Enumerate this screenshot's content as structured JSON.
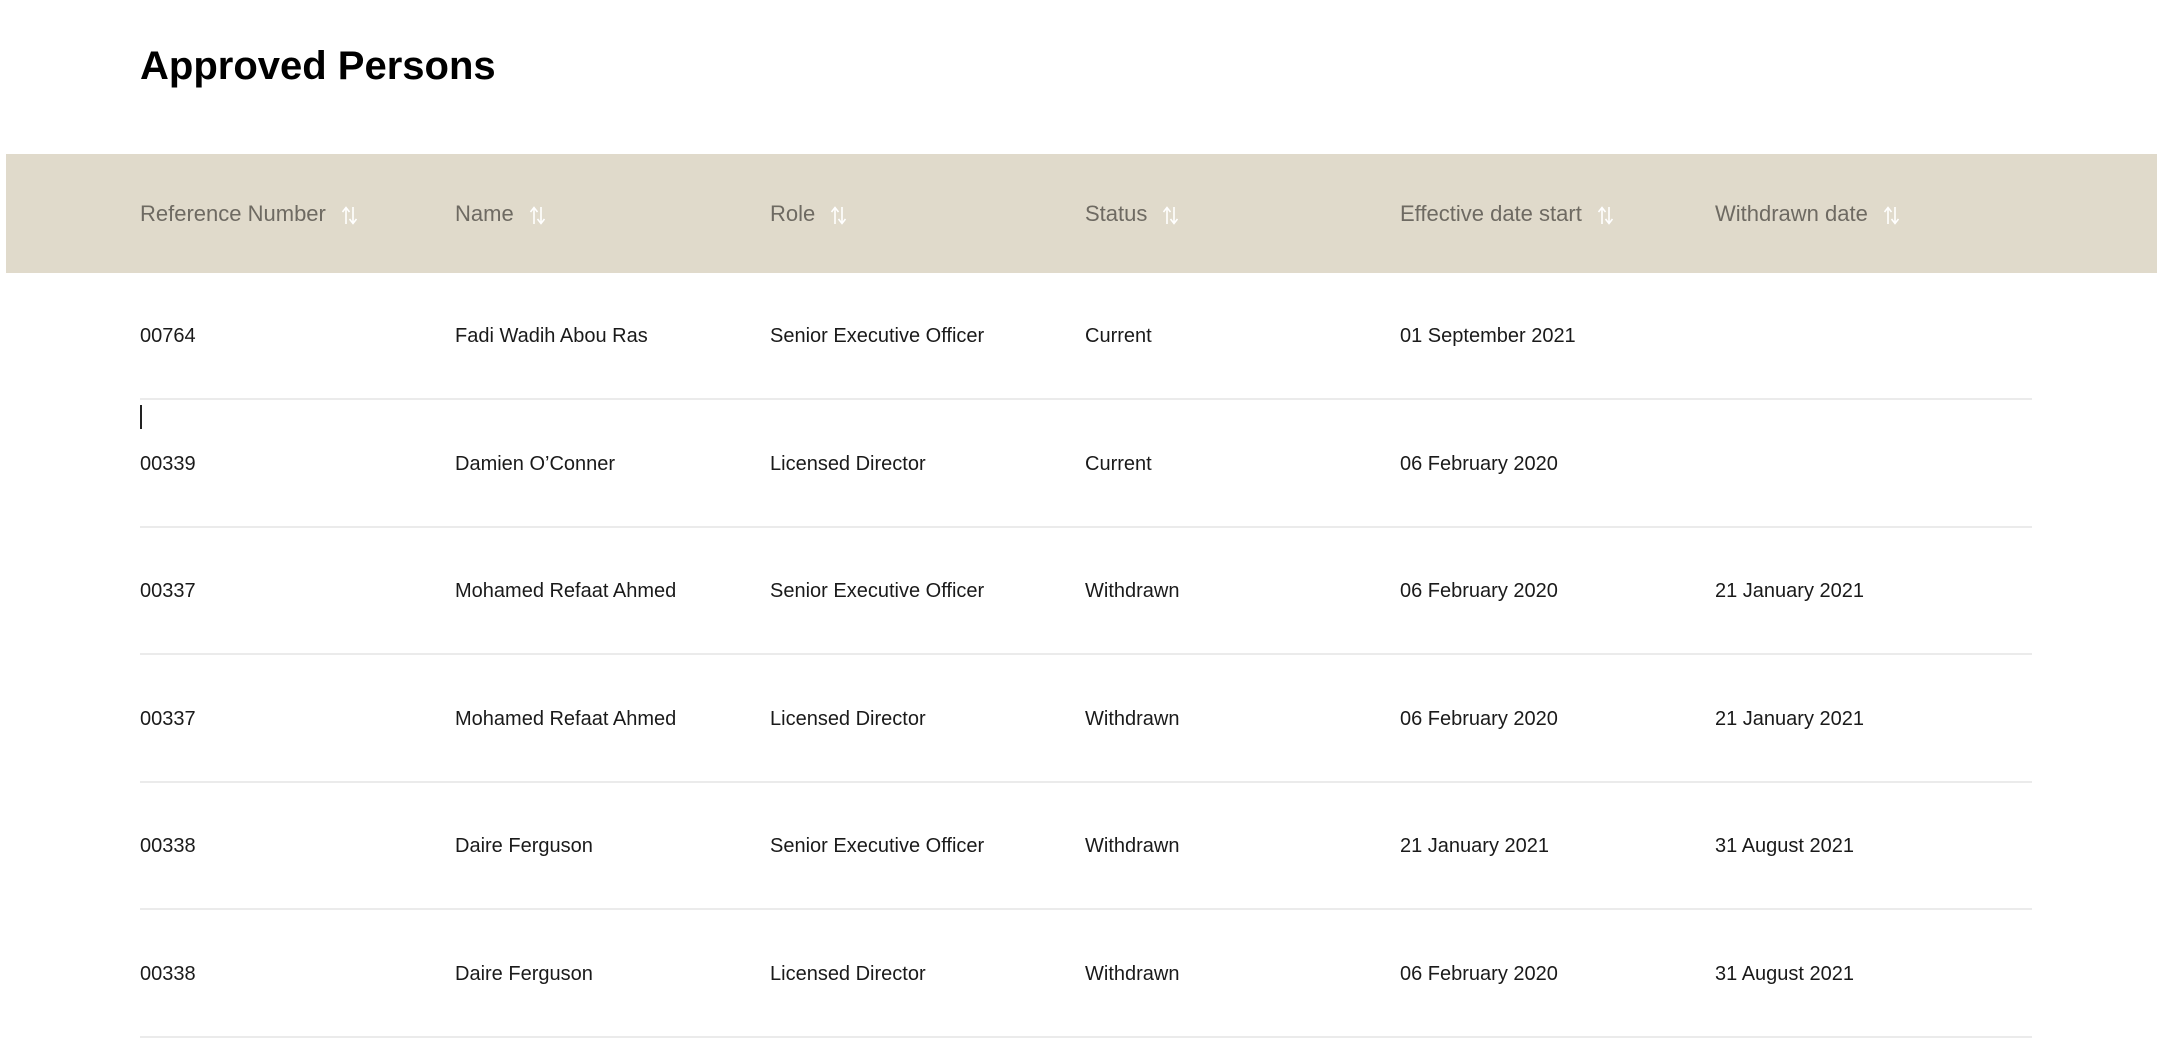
{
  "page": {
    "title": "Approved Persons"
  },
  "table": {
    "columns": [
      {
        "label": "Reference Number",
        "sort_icon": "sort-up-down-icon"
      },
      {
        "label": "Name",
        "sort_icon": "sort-up-down-icon"
      },
      {
        "label": "Role",
        "sort_icon": "sort-up-down-icon"
      },
      {
        "label": "Status",
        "sort_icon": "sort-up-down-icon"
      },
      {
        "label": "Effective date start",
        "sort_icon": "sort-up-down-icon"
      },
      {
        "label": "Withdrawn date",
        "sort_icon": "sort-up-down-icon"
      }
    ],
    "rows": [
      {
        "ref": "00764",
        "name": "Fadi Wadih Abou Ras",
        "role": "Senior Executive Officer",
        "status": "Current",
        "start": "01 September 2021",
        "withdrawn": ""
      },
      {
        "ref": "00339",
        "name": "Damien O’Conner",
        "role": "Licensed Director",
        "status": "Current",
        "start": "06 February 2020",
        "withdrawn": ""
      },
      {
        "ref": "00337",
        "name": "Mohamed Refaat Ahmed",
        "role": "Senior Executive Officer",
        "status": "Withdrawn",
        "start": "06 February 2020",
        "withdrawn": "21 January 2021"
      },
      {
        "ref": "00337",
        "name": "Mohamed Refaat Ahmed",
        "role": "Licensed Director",
        "status": "Withdrawn",
        "start": "06 February 2020",
        "withdrawn": "21 January 2021"
      },
      {
        "ref": "00338",
        "name": "Daire Ferguson",
        "role": "Senior Executive Officer",
        "status": "Withdrawn",
        "start": "21 January 2021",
        "withdrawn": "31 August 2021"
      },
      {
        "ref": "00338",
        "name": "Daire Ferguson",
        "role": "Licensed Director",
        "status": "Withdrawn",
        "start": "06 February 2020",
        "withdrawn": "31 August 2021"
      }
    ]
  },
  "colors": {
    "header_background": "#e0dacb",
    "header_text": "#6e6a62",
    "sort_icon": "#ffffff",
    "row_divider": "#ebebeb"
  }
}
